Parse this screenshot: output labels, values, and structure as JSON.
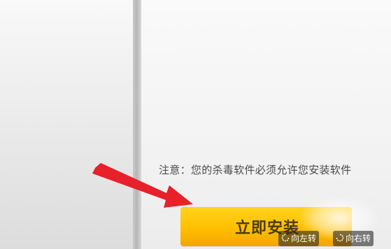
{
  "notice": {
    "text": "注意：您的杀毒软件必须允许您安装软件"
  },
  "install_button": {
    "label": "立即安装"
  },
  "image_controls": {
    "rotate_left_label": "向左转",
    "rotate_right_label": "向右转"
  },
  "colors": {
    "button_yellow": "#ffbf00",
    "arrow_red": "#e8202a"
  },
  "icons": {
    "rotate_left": "rotate-left-icon",
    "rotate_right": "rotate-right-icon",
    "arrow": "pointer-arrow-icon"
  }
}
